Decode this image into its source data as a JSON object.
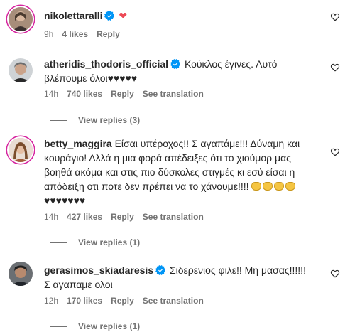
{
  "comments": [
    {
      "username": "nikolettaralli",
      "verified": true,
      "text": "❤",
      "time": "9h",
      "likes": "4 likes",
      "reply_label": "Reply",
      "see_translation": ""
    },
    {
      "username": "atheridis_thodoris_official",
      "verified": true,
      "text": "Κούκλος έγινες. Αυτό βλέπουμε όλοι♥♥♥♥♥",
      "time": "14h",
      "likes": "740 likes",
      "reply_label": "Reply",
      "see_translation": "See translation",
      "view_replies": "View replies (3)"
    },
    {
      "username": "betty_maggira",
      "verified": false,
      "text": "Είσαι υπέροχος!! Σ αγαπάμε!!! Δύναμη και κουράγιο! Αλλά η μια φορά απέδειξες ότι το χιούμορ μας βοηθά ακόμα και στις πιο δύσκολες στιγμές κι εσύ είσαι η απόδειξη οτι ποτε δεν πρέπει να το χάνουμε!!!! ",
      "text_end": "♥♥♥♥♥♥♥",
      "time": "14h",
      "likes": "427 likes",
      "reply_label": "Reply",
      "see_translation": "See translation",
      "view_replies": "View replies (1)"
    },
    {
      "username": "gerasimos_skiadaresis",
      "verified": true,
      "text": "Σιδερενιος φιλε!! Μη μασας!!!!!! Σ αγαπαμε ολοι",
      "time": "12h",
      "likes": "170 likes",
      "reply_label": "Reply",
      "see_translation": "See translation",
      "view_replies": "View replies (1)"
    }
  ],
  "colors": {
    "verified": "#0095f6",
    "heart_red": "#ed4956",
    "muted": "#737373"
  },
  "icons": {
    "verified": "verified-badge-icon",
    "like": "heart-outline-icon"
  }
}
